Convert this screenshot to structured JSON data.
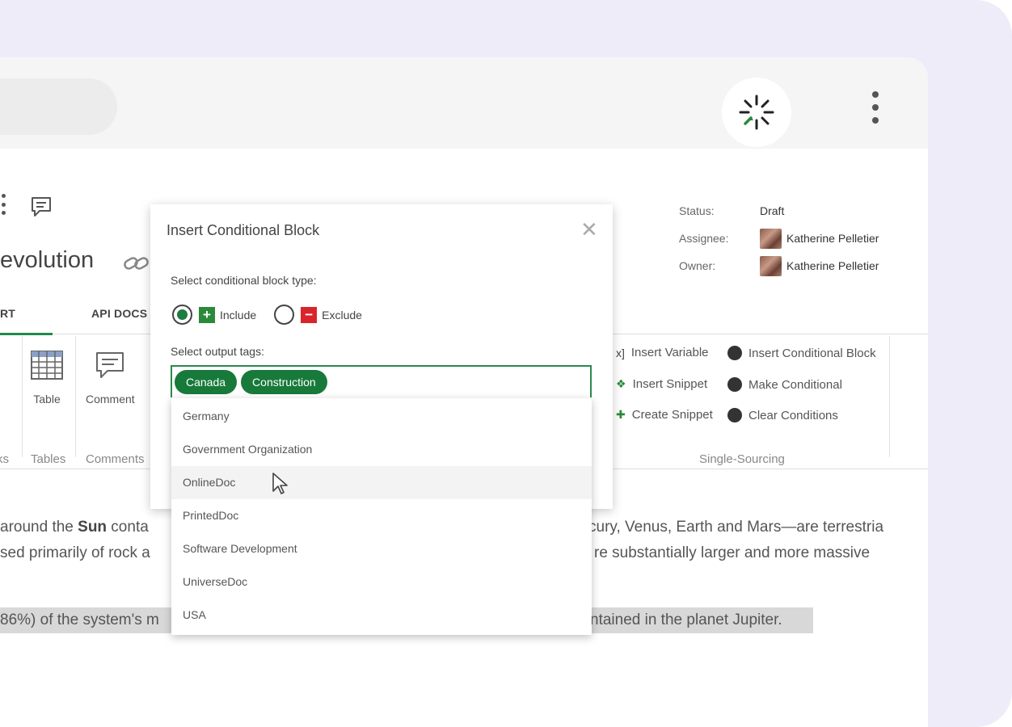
{
  "app": {
    "doc_title": "evolution",
    "meta": {
      "status_label": "Status:",
      "status_value": "Draft",
      "assignee_label": "Assignee:",
      "assignee_value": "Katherine Pelletier",
      "owner_label": "Owner:",
      "owner_value": "Katherine Pelletier"
    },
    "tabs": [
      "RT",
      "API DOCS"
    ],
    "ribbon": {
      "table_label": "Table",
      "comment_label": "Comment",
      "groups": [
        "ks",
        "Tables",
        "Comments",
        "Single-Sourcing"
      ],
      "single_sourcing": {
        "insert_variable": "Insert Variable",
        "insert_snippet": "Insert Snippet",
        "create_snippet": "Create Snippet",
        "insert_conditional_block": "Insert Conditional Block",
        "make_conditional": "Make Conditional",
        "clear_conditions": "Clear Conditions"
      }
    }
  },
  "content": {
    "line1_a": "around the ",
    "line1_bold": "Sun",
    "line1_b": " conta",
    "line1_right": "cury, Venus, Earth and Mars—are terrestria",
    "line2_left": "sed primarily of rock a",
    "line2_right": "re substantially larger and more massive",
    "line3_left": "86%) of the system's m",
    "line3_right": "ntained in the planet Jupiter."
  },
  "dialog": {
    "title": "Insert Conditional Block",
    "close_symbol": "✕",
    "block_type_label": "Select conditional block type:",
    "include_label": "Include",
    "exclude_label": "Exclude",
    "selected_type": "Include",
    "output_tags_label": "Select output tags:",
    "selected_tags": [
      "Canada",
      "Construction"
    ],
    "options": [
      "Germany",
      "Government Organization",
      "OnlineDoc",
      "PrintedDoc",
      "Software Development",
      "UniverseDoc",
      "USA"
    ],
    "hovered_option": "OnlineDoc"
  },
  "colors": {
    "accent_green": "#187a3a",
    "exclude_red": "#d9242b",
    "frame_lavender": "#efecfa"
  },
  "icons": [
    "extension-icon",
    "kebab-menu-icon",
    "comment-icon",
    "link-icon",
    "table-icon",
    "plus-icon",
    "minus-icon",
    "mouse-pointer-icon"
  ]
}
